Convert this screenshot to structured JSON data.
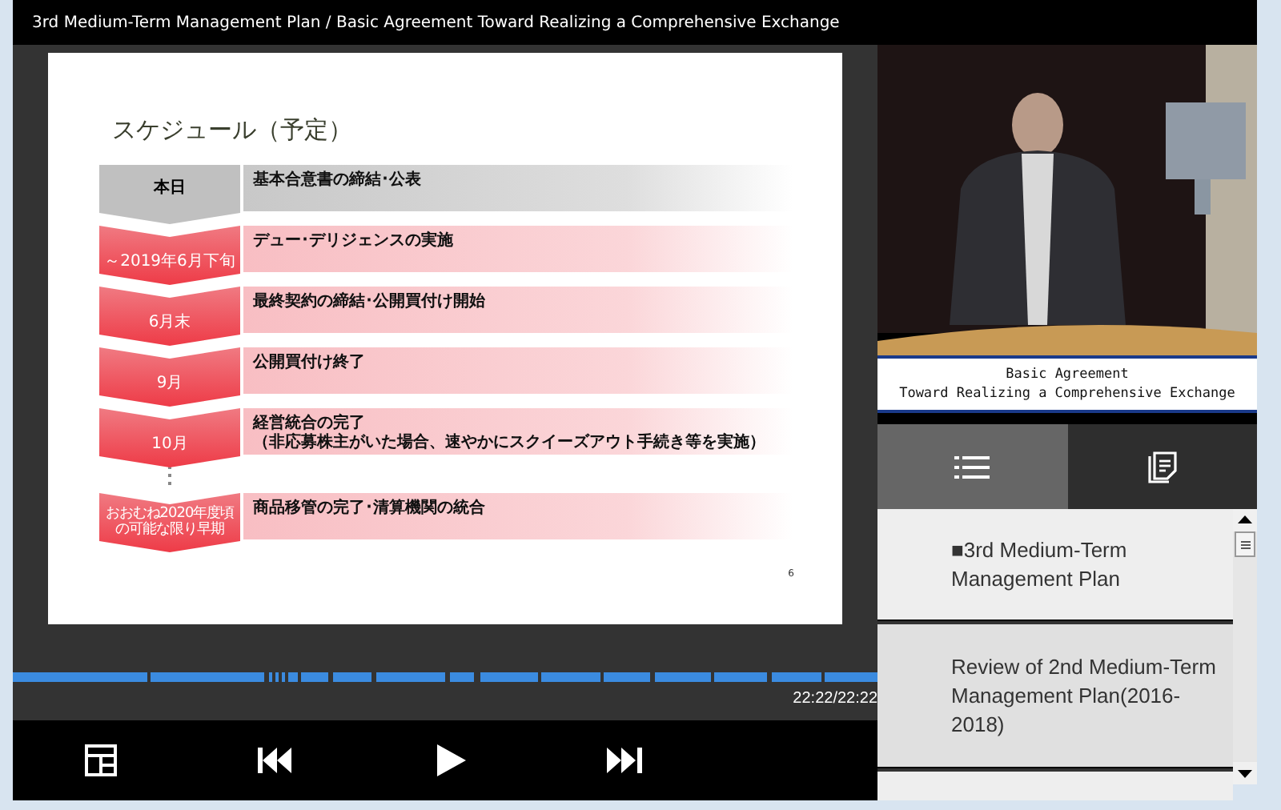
{
  "window": {
    "title": "3rd Medium-Term Management Plan / Basic Agreement Toward Realizing a Comprehensive Exchange"
  },
  "slide": {
    "title": "スケジュール（予定）",
    "page": "6",
    "rows": [
      {
        "kind": "gray",
        "label": "本日",
        "text": "基本合意書の締結･公表"
      },
      {
        "kind": "red",
        "label": "～2019年6月下旬",
        "text": "デュー･デリジェンスの実施"
      },
      {
        "kind": "red",
        "label": "6月末",
        "text": "最終契約の締結･公開買付け開始"
      },
      {
        "kind": "red",
        "label": "9月",
        "text": "公開買付け終了"
      },
      {
        "kind": "red",
        "label": "10月",
        "text": "経営統合の完了",
        "note": "（非応募株主がいた場合、速やかにスクイーズアウト手続き等を実施）"
      },
      {
        "kind": "dots"
      },
      {
        "kind": "red",
        "label": "おおむね2020年度頃の可能な限り早期",
        "text": "商品移管の完了･清算機関の統合"
      }
    ]
  },
  "player": {
    "time": "22:22/22:22"
  },
  "video": {
    "caption": [
      "Basic Agreement",
      "Toward Realizing a Comprehensive Exchange"
    ]
  },
  "tabs": [
    {
      "kind": "list",
      "selected": true
    },
    {
      "kind": "notes",
      "selected": false
    }
  ],
  "chapters": [
    {
      "title": "■3rd Medium-Term Management Plan",
      "selected": false
    },
    {
      "title": "Review of 2nd Medium-Term Management Plan(2016-2018)",
      "selected": true
    }
  ]
}
